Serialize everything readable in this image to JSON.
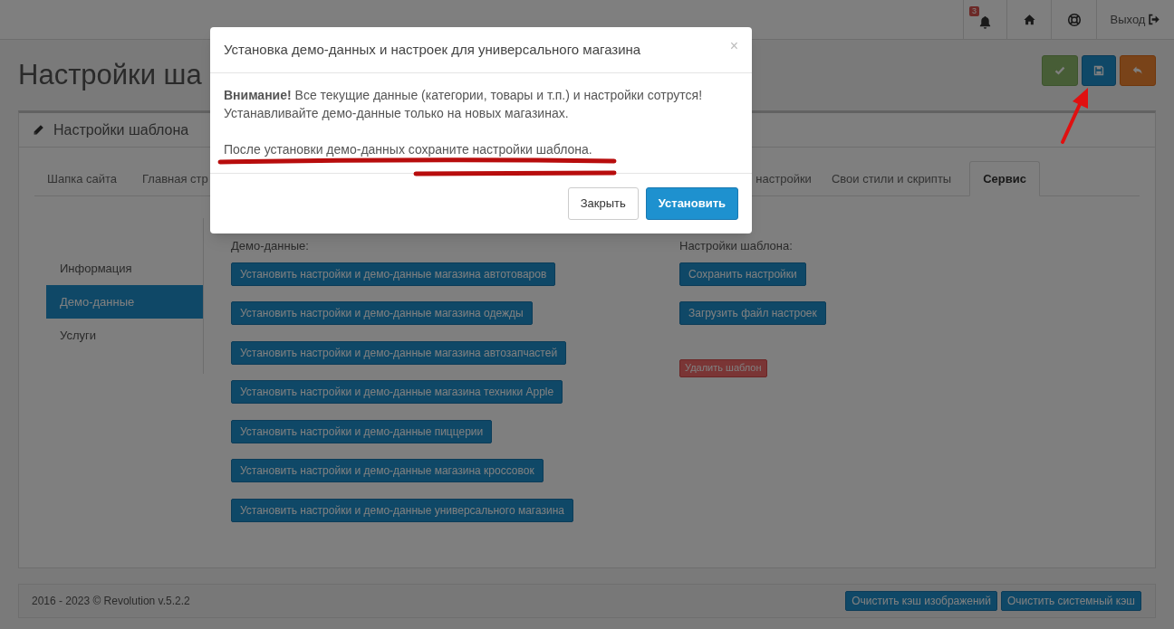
{
  "topbar": {
    "notifications_badge": "3",
    "logout": "Выход"
  },
  "page_title": "Настройки ша",
  "panel": {
    "title": "Настройки шаблона",
    "tabs": [
      {
        "label": "Шапка сайта",
        "selected": false
      },
      {
        "label": "Главная стр",
        "selected": false
      },
      {
        "label": "настройки",
        "selected": false
      },
      {
        "label": "Свои стили и скрипты",
        "selected": false
      },
      {
        "label": "Сервис",
        "selected": true
      }
    ],
    "side_nav": [
      {
        "label": "Информация",
        "selected": false
      },
      {
        "label": "Демо-данные",
        "selected": true
      },
      {
        "label": "Услуги",
        "selected": false
      }
    ],
    "demo": {
      "heading": "Демо-данные:",
      "buttons": [
        "Установить настройки и демо-данные магазина автотоваров",
        "Установить настройки и демо-данные магазина одежды",
        "Установить настройки и демо-данные магазина автозапчастей",
        "Установить настройки и демо-данные магазина техники Apple",
        "Установить настройки и демо-данные пиццерии",
        "Установить настройки и демо-данные магазина кроссовок",
        "Установить настройки и демо-данные универсального магазина"
      ]
    },
    "settings": {
      "heading": "Настройки шаблона:",
      "buttons": [
        {
          "label": "Сохранить настройки",
          "kind": "primary"
        },
        {
          "label": "Загрузить файл настроек",
          "kind": "primary"
        },
        {
          "label": "Удалить шаблон",
          "kind": "danger"
        }
      ]
    }
  },
  "footer": {
    "copyright": "2016 - 2023 © Revolution v.5.2.2",
    "buttons": [
      "Очистить кэш изображений",
      "Очистить системный кэш"
    ]
  },
  "modal": {
    "title": "Установка демо-данных и настроек для универсального магазина",
    "close": "×",
    "warning": "**Внимание!** Все текущие данные (категории, товары и т.п.) и настройки сотрутся! Устанавливайте демо-данные только на новых магазинах.",
    "note": "После установки демо-данных сохраните настройки шаблона.",
    "buttons": [
      {
        "label": "Закрыть",
        "kind": "default"
      },
      {
        "label": "Установить",
        "kind": "primary"
      }
    ]
  }
}
